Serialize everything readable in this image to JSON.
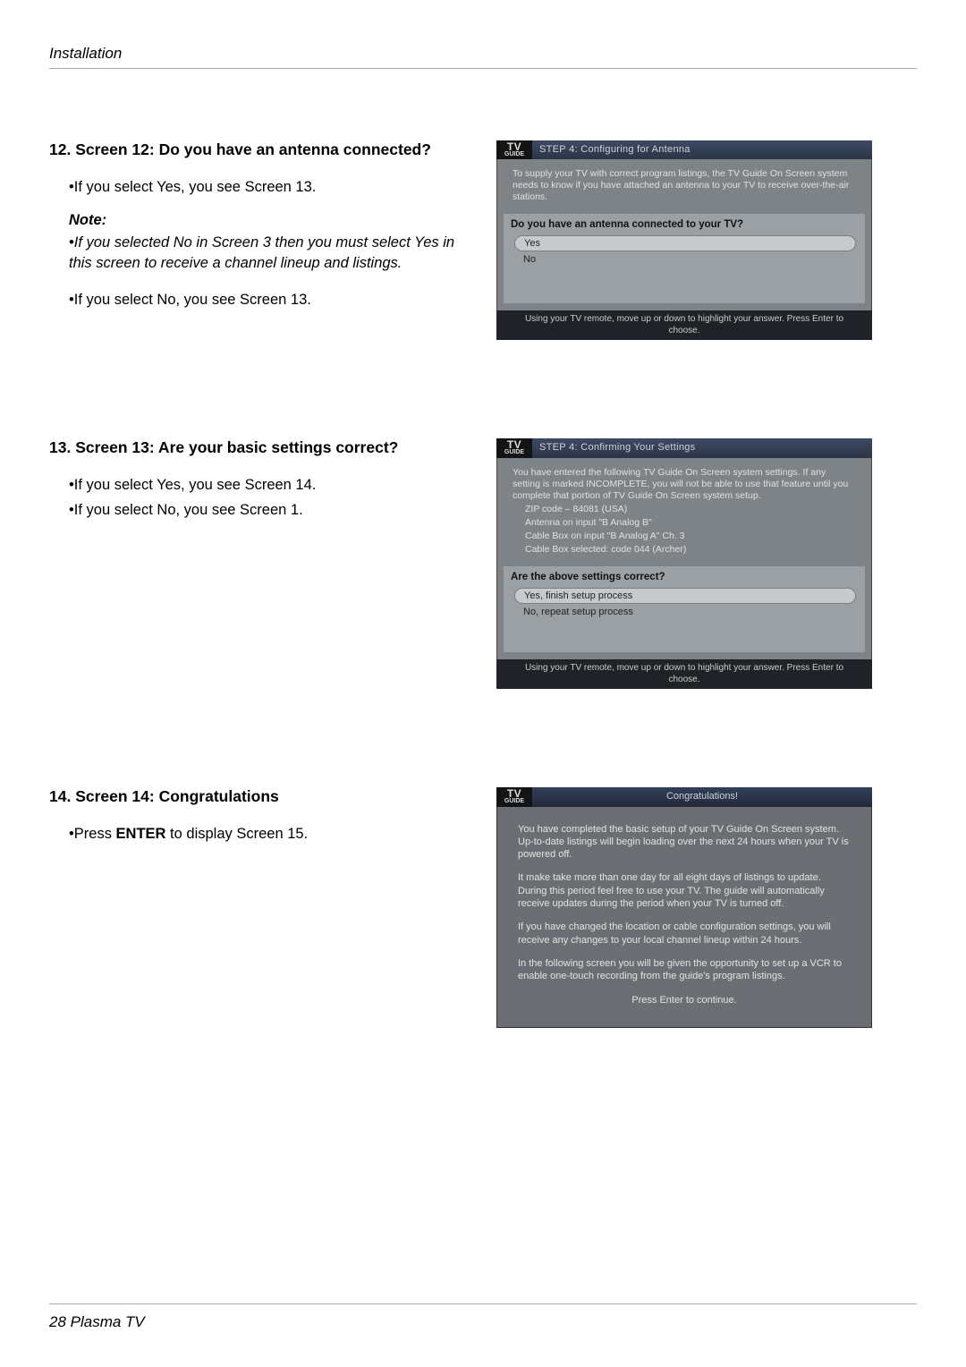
{
  "header": {
    "section_label": "Installation"
  },
  "tv_logo": {
    "line1": "TV",
    "line2": "GUIDE"
  },
  "s12": {
    "title": "12. Screen 12: Do you have an antenna connected?",
    "bullet_yes": "•If you select Yes, you see Screen 13.",
    "note_label": "Note:",
    "note_body": "•If you selected No in Screen 3 then you must select Yes in this screen to receive a channel lineup and listings.",
    "bullet_no": "•If you select No, you see Screen 13.",
    "shot": {
      "titlebar": "STEP 4: Configuring for Antenna",
      "intro": "To supply your TV with correct program listings, the TV Guide On Screen system needs to know if you have attached an antenna to your TV to receive over-the-air stations.",
      "question": "Do you have an antenna connected to your TV?",
      "opt_yes": "Yes",
      "opt_no": "No",
      "footer": "Using your TV remote, move up or down to highlight your answer.  Press Enter to choose."
    }
  },
  "s13": {
    "title": "13. Screen 13: Are your basic settings correct?",
    "bullet_yes": "•If you select Yes, you see Screen 14.",
    "bullet_no": "•If you select No, you see Screen 1.",
    "shot": {
      "titlebar": "STEP 4: Confirming Your Settings",
      "intro": "You have entered the following TV Guide On Screen system settings. If any setting is marked INCOMPLETE, you will not be able to use that feature until you complete that portion of TV Guide On Screen system setup.",
      "line1": "ZIP code – 84081 (USA)",
      "line2": "Antenna on input \"B Analog B\"",
      "line3": "Cable Box on input \"B Analog A\" Ch. 3",
      "line4": "Cable Box selected: code 044 (Archer)",
      "question": "Are the above settings correct?",
      "opt_yes": "Yes, finish setup process",
      "opt_no": "No, repeat setup process",
      "footer": "Using your TV remote, move up or down to highlight your answer.  Press Enter to choose."
    }
  },
  "s14": {
    "title": "14. Screen 14: Congratulations",
    "bullet_pre": "•Press ",
    "bullet_bold": "ENTER",
    "bullet_post": " to display Screen 15.",
    "shot": {
      "titlebar": "Congratulations!",
      "p1": "You have completed the basic setup of your TV Guide On Screen system.  Up-to-date listings will begin loading over the next 24 hours when your TV is powered off.",
      "p2": "It make take more than one day for all eight days of listings to update.  During this period feel free to use your TV.  The guide will automatically receive updates during the period when your TV is turned off.",
      "p3": "If you have changed the location or cable configuration settings, you will receive any changes to your local channel lineup within 24 hours.",
      "p4": "In the following screen you will be given the opportunity to set up a VCR to enable one-touch recording from the guide's program listings.",
      "press": "Press Enter to continue."
    }
  },
  "footer": {
    "text": "28  Plasma TV"
  }
}
